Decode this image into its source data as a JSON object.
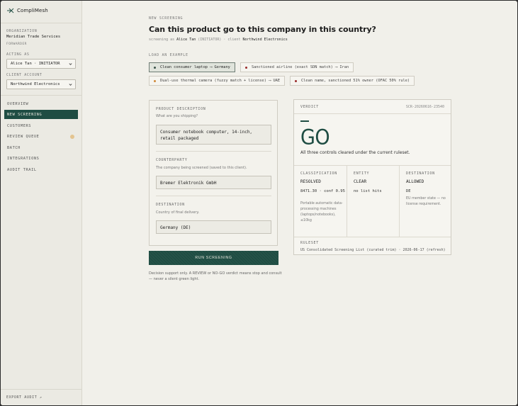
{
  "app": {
    "name": "CompliMesh"
  },
  "sidebar": {
    "org_label": "Organization",
    "org_name": "Meridian Trade Services",
    "org_role": "Forwarder",
    "acting_label": "Acting as",
    "acting_value": "Alice Tan · INITIATOR",
    "client_label": "Client account",
    "client_value": "Northwind Electronics",
    "nav": [
      {
        "label": "Overview"
      },
      {
        "label": "New screening"
      },
      {
        "label": "Customers"
      },
      {
        "label": "Review queue"
      },
      {
        "label": "Batch"
      },
      {
        "label": "Integrations"
      },
      {
        "label": "Audit trail"
      }
    ],
    "export_label": "Export audit ↗"
  },
  "header": {
    "eyebrow": "New screening",
    "title": "Can this product go to this company in this country?",
    "sub_prefix": "screening as",
    "sub_user": "Alice Tan",
    "sub_role": "(INITIATOR) · client",
    "sub_client": "Northwind Electronics"
  },
  "examples": {
    "label": "Load an example",
    "items": [
      {
        "label": "Clean consumer laptop ⟶ Germany",
        "dot_color": "#4a6a5e",
        "selected": true
      },
      {
        "label": "Sanctioned airline (exact SDN match) ⟶ Iran",
        "dot_color": "#9a2b2b",
        "selected": false
      },
      {
        "label": "Dual-use thermal camera (fuzzy match + license) ⟶ UAE",
        "dot_color": "#d08a3a",
        "selected": false
      },
      {
        "label": "Clean name, sanctioned 51% owner (OFAC 50% rule)",
        "dot_color": "#9a2b2b",
        "selected": false
      }
    ]
  },
  "form": {
    "product_label": "Product description",
    "product_help": "What are you shipping?",
    "product_value": "Consumer notebook computer, 14-inch, retail packaged",
    "party_label": "Counterparty",
    "party_help": "The company being screened (saved to this client).",
    "party_value": "Bremer Elektronik GmbH",
    "dest_label": "Destination",
    "dest_help": "Country of final delivery.",
    "dest_value": "Germany (DE)",
    "run_label": "Run screening",
    "disclaimer": "Decision support only. A REVIEW or NO-GO verdict means stop and consult — never a silent green light."
  },
  "verdict": {
    "label": "Verdict",
    "id": "SCR-20260616-23540",
    "result": "GO",
    "summary": "All three controls cleared under the current ruleset.",
    "classification": {
      "label": "Classification",
      "value": "Resolved",
      "code": "8471.30 · conf 0.95",
      "note": "Portable automatic data-processing machines (laptops/notebooks), ≤10kg"
    },
    "entity": {
      "label": "Entity",
      "value": "Clear",
      "detail": "no list hits"
    },
    "destination": {
      "label": "Destination",
      "value": "Allowed",
      "code": "DE",
      "note": "EU member state — no license requirement."
    },
    "ruleset_label": "Ruleset",
    "ruleset_value": "US Consolidated Screening List (curated trim) · 2026-06-17 (refresh)"
  },
  "colors": {
    "accent": "#1f4d43",
    "background": "#f1f0ea",
    "sidebar": "#ebeae3",
    "badge": "#e3c490"
  }
}
